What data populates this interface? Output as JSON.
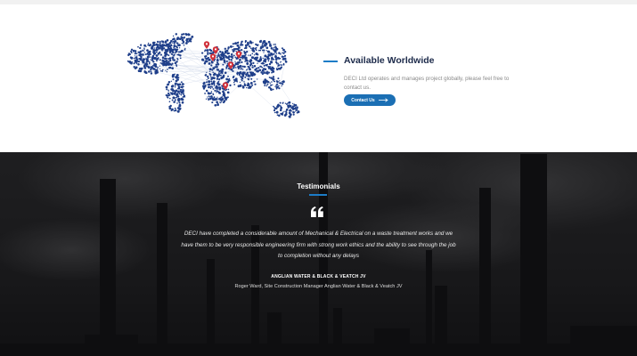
{
  "worldwide": {
    "title": "Available Worldwide",
    "description": "DECI Ltd operates and manages project globally, please feel free to contact us.",
    "button_label": "Contact Us",
    "accent_color": "#1c7cc7",
    "button_color": "#1b6fb4",
    "pin_color": "#d0313a",
    "dot_color": "#1f3f8a"
  },
  "testimonials": {
    "title": "Testimonials",
    "quote": "DECI have completed a considerable amount of Mechanical & Electrical on a waste treatment works and we have them to be very responsible engineering firm with strong work ethics and the ability to see through the job to completion without any delays",
    "company": "ANGLIAN WATER & BLACK & VEATCH JV",
    "author": "Roger Ward, Site Construction Manager Anglian Water & Black & Veatch JV",
    "icon": "quote-icon",
    "background": "industrial-chimneys-photo"
  }
}
